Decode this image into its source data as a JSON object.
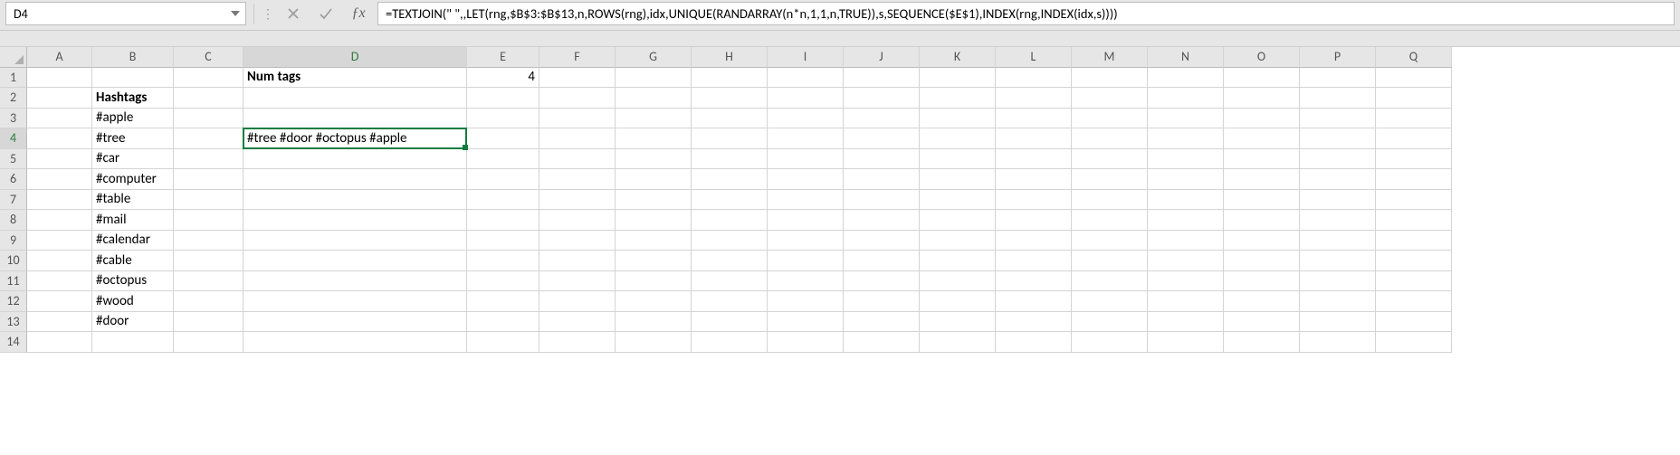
{
  "namebox": {
    "value": "D4"
  },
  "formula_bar": {
    "formula": "=TEXTJOIN(\" \",,LET(rng,$B$3:$B$13,n,ROWS(rng),idx,UNIQUE(RANDARRAY(n*n,1,1,n,TRUE)),s,SEQUENCE($E$1),INDEX(rng,INDEX(idx,s))))"
  },
  "columns": [
    "A",
    "B",
    "C",
    "D",
    "E",
    "F",
    "G",
    "H",
    "I",
    "J",
    "K",
    "L",
    "M",
    "N",
    "O",
    "P",
    "Q"
  ],
  "rows": [
    "1",
    "2",
    "3",
    "4",
    "5",
    "6",
    "7",
    "8",
    "9",
    "10",
    "11",
    "12",
    "13",
    "14"
  ],
  "active": {
    "col": "D",
    "row": "4"
  },
  "cells": {
    "D1": {
      "v": "Num tags",
      "bold": true
    },
    "E1": {
      "v": "4",
      "num": true
    },
    "B2": {
      "v": "Hashtags",
      "bold": true
    },
    "B3": {
      "v": "#apple"
    },
    "B4": {
      "v": "#tree"
    },
    "B5": {
      "v": "#car"
    },
    "B6": {
      "v": "#computer"
    },
    "B7": {
      "v": "#table"
    },
    "B8": {
      "v": "#mail"
    },
    "B9": {
      "v": "#calendar"
    },
    "B10": {
      "v": "#cable"
    },
    "B11": {
      "v": "#octopus"
    },
    "B12": {
      "v": "#wood"
    },
    "B13": {
      "v": "#door"
    },
    "D4": {
      "v": "#tree #door #octopus #apple"
    }
  }
}
